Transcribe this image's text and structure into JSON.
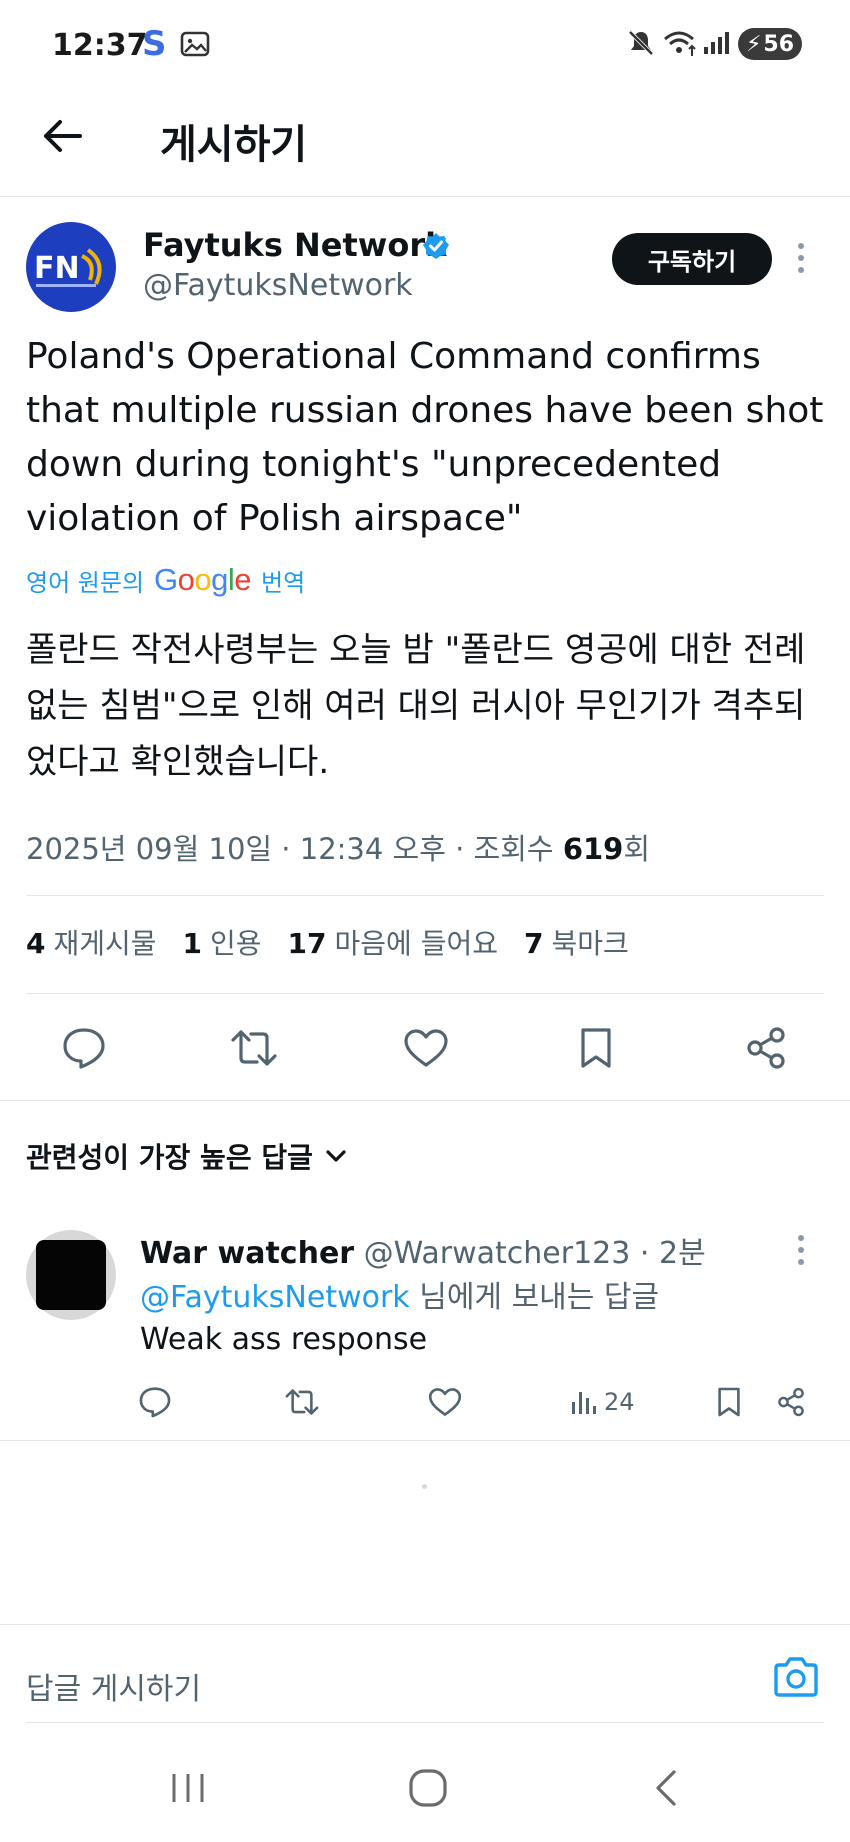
{
  "status_bar": {
    "time": "12:37",
    "s_icon": "S",
    "battery": "56",
    "icons": [
      "gallery-icon",
      "mute-icon",
      "wifi-icon",
      "signal-icon",
      "battery-charging-icon"
    ]
  },
  "header": {
    "title": "게시하기"
  },
  "post": {
    "author_name": "Faytuks Network",
    "author_handle": "@FaytuksNetwork",
    "subscribe_label": "구독하기",
    "text": "Poland's Operational Command confirms that multiple russian drones have been shot down during tonight's \"unprecedented violation of Polish airspace\"",
    "translate_prefix": "영어 원문의",
    "translate_brand": "Google",
    "translate_suffix": "번역",
    "translated_text": "폴란드 작전사령부는 오늘 밤 \"폴란드 영공에 대한 전례 없는 침범\"으로 인해 여러 대의 러시아 무인기가 격추되었다고 확인했습니다.",
    "date": "2025년 09월 10일 · 12:34 오후 · 조회수",
    "views": "619",
    "views_suffix": "회",
    "stats": {
      "reposts_count": "4",
      "reposts_label": "재게시물",
      "quotes_count": "1",
      "quotes_label": "인용",
      "likes_count": "17",
      "likes_label": "마음에 들어요",
      "bookmarks_count": "7",
      "bookmarks_label": "북마크"
    }
  },
  "replies": {
    "sort_label": "관련성이 가장 높은 답글",
    "items": [
      {
        "name": "War watcher",
        "handle": "@Warwatcher123",
        "time": "· 2분",
        "reply_to_mention": "@FaytuksNetwork",
        "reply_to_suffix": "님에게 보내는 답글",
        "text": "Weak ass response",
        "views": "24"
      }
    ]
  },
  "compose": {
    "placeholder": "답글 게시하기"
  },
  "colors": {
    "accent": "#1d9bf0",
    "text": "#0f1419",
    "secondary": "#536471",
    "avatar_bg": "#1e3ec0"
  }
}
